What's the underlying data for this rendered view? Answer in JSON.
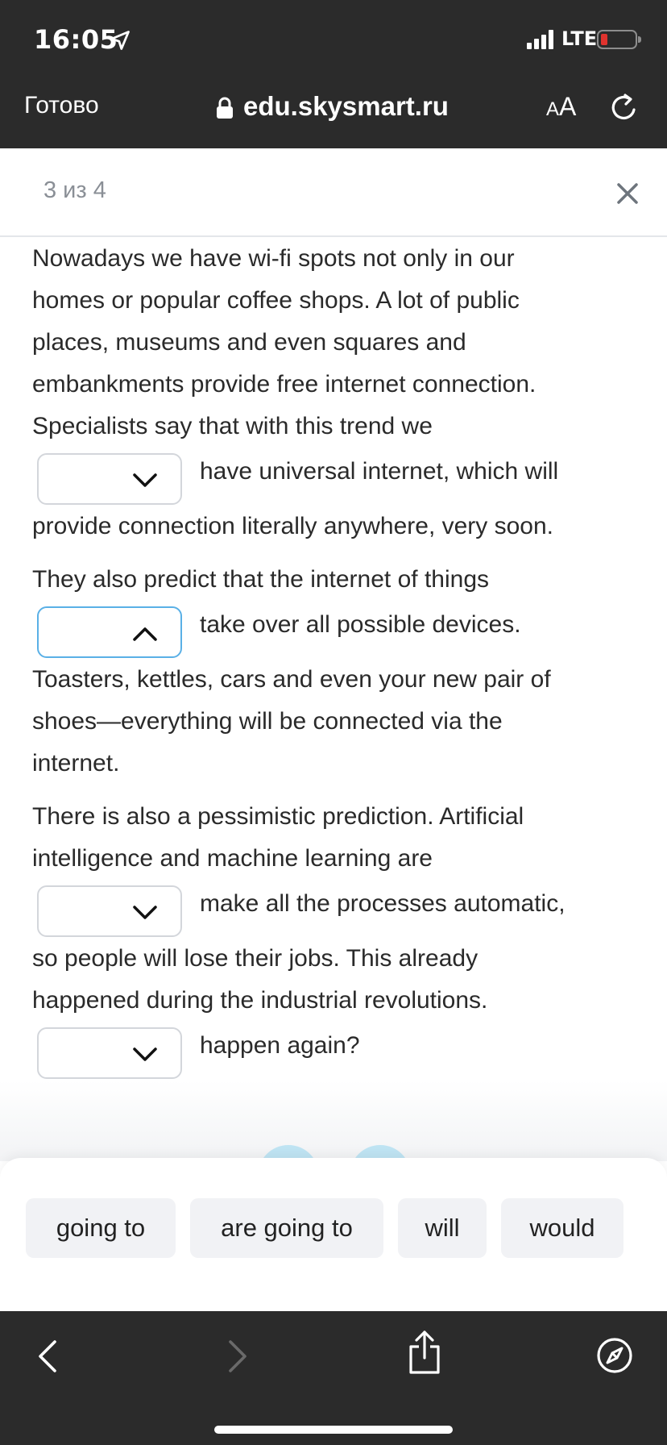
{
  "status_bar": {
    "time": "16:05",
    "network": "LTE"
  },
  "browser": {
    "done_label": "Готово",
    "url": "edu.skysmart.ru",
    "text_size_small": "A",
    "text_size_big": "A"
  },
  "page": {
    "counter": "3 из 4"
  },
  "exercise": {
    "lines": [
      "Nowadays we have wi-fi spots not only in our",
      "homes or popular coffee shops. A lot of public",
      "places, museums and even squares and",
      "embankments provide free internet connection.",
      "Specialists say that with this trend we",
      "provide connection literally anywhere, very soon.",
      "They also predict that the internet of things",
      "Toasters, kettles, cars and even your new pair of",
      "shoes—everything will be connected via the",
      "internet.",
      "There is also a pessimistic prediction. Artificial",
      "intelligence and machine learning are",
      "so people will lose their jobs. This already",
      "happened during the industrial revolutions."
    ],
    "blanks": [
      {
        "after_text": "have universal internet, which will",
        "selected": "",
        "state": "collapsed"
      },
      {
        "after_text": "take over all possible devices.",
        "selected": "",
        "state": "expanded"
      },
      {
        "after_text": "make all the processes automatic,",
        "selected": "",
        "state": "collapsed"
      },
      {
        "after_text": "happen again?",
        "selected": "",
        "state": "collapsed"
      }
    ]
  },
  "options": [
    "going to",
    "are going to",
    "will",
    "would"
  ],
  "colors": {
    "chrome": "#2b2b2b",
    "accent_border": "#5ab0e6",
    "option_bg": "#f1f2f5"
  },
  "icons": [
    "location-arrow-icon",
    "signal-icon",
    "battery-icon",
    "lock-icon",
    "reload-icon",
    "close-icon",
    "chevron-down-icon",
    "chevron-up-icon",
    "back-icon",
    "forward-icon",
    "share-icon",
    "compass-icon"
  ]
}
